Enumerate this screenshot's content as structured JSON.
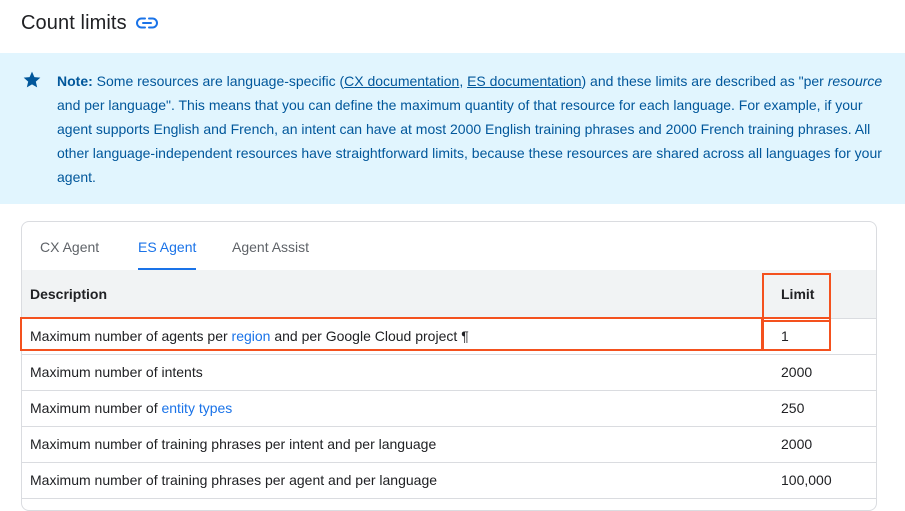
{
  "heading": {
    "title": "Count limits",
    "icon": "link-icon"
  },
  "note": {
    "label": "Note:",
    "text_1": " Some resources are language-specific (",
    "link_cx": "CX documentation",
    "sep": ", ",
    "link_es": "ES documentation",
    "text_2": ") and these limits are described as \"per ",
    "emph": "resource",
    "text_3": " and per language\". This means that you can define the maximum quantity of that resource for each language. For example, if your agent supports English and French, an intent can have at most 2000 English training phrases and 2000 French training phrases. All other language-independent resources have straightforward limits, because these resources are shared across all languages for your agent.",
    "icon": "star-icon"
  },
  "tabs": [
    {
      "label": "CX Agent"
    },
    {
      "label": "ES Agent",
      "active": true
    },
    {
      "label": "Agent Assist"
    }
  ],
  "table": {
    "headers": {
      "description": "Description",
      "limit": "Limit"
    },
    "rows": [
      {
        "pre": "Maximum number of agents per ",
        "link": "region",
        "post": " and per Google Cloud project",
        "anchor": "¶",
        "limit": "1"
      },
      {
        "pre": "Maximum number of intents",
        "link": "",
        "post": "",
        "limit": "2000"
      },
      {
        "pre": "Maximum number of ",
        "link": "entity types",
        "post": "",
        "limit": "250"
      },
      {
        "pre": "Maximum number of training phrases per intent and per language",
        "link": "",
        "post": "",
        "limit": "2000"
      },
      {
        "pre": "Maximum number of training phrases per agent and per language",
        "link": "",
        "post": "",
        "limit": "100,000"
      }
    ]
  },
  "colors": {
    "accent": "#1a73e8",
    "note_bg": "#e1f5fe",
    "note_text": "#01579b",
    "highlight": "#f4511e"
  }
}
